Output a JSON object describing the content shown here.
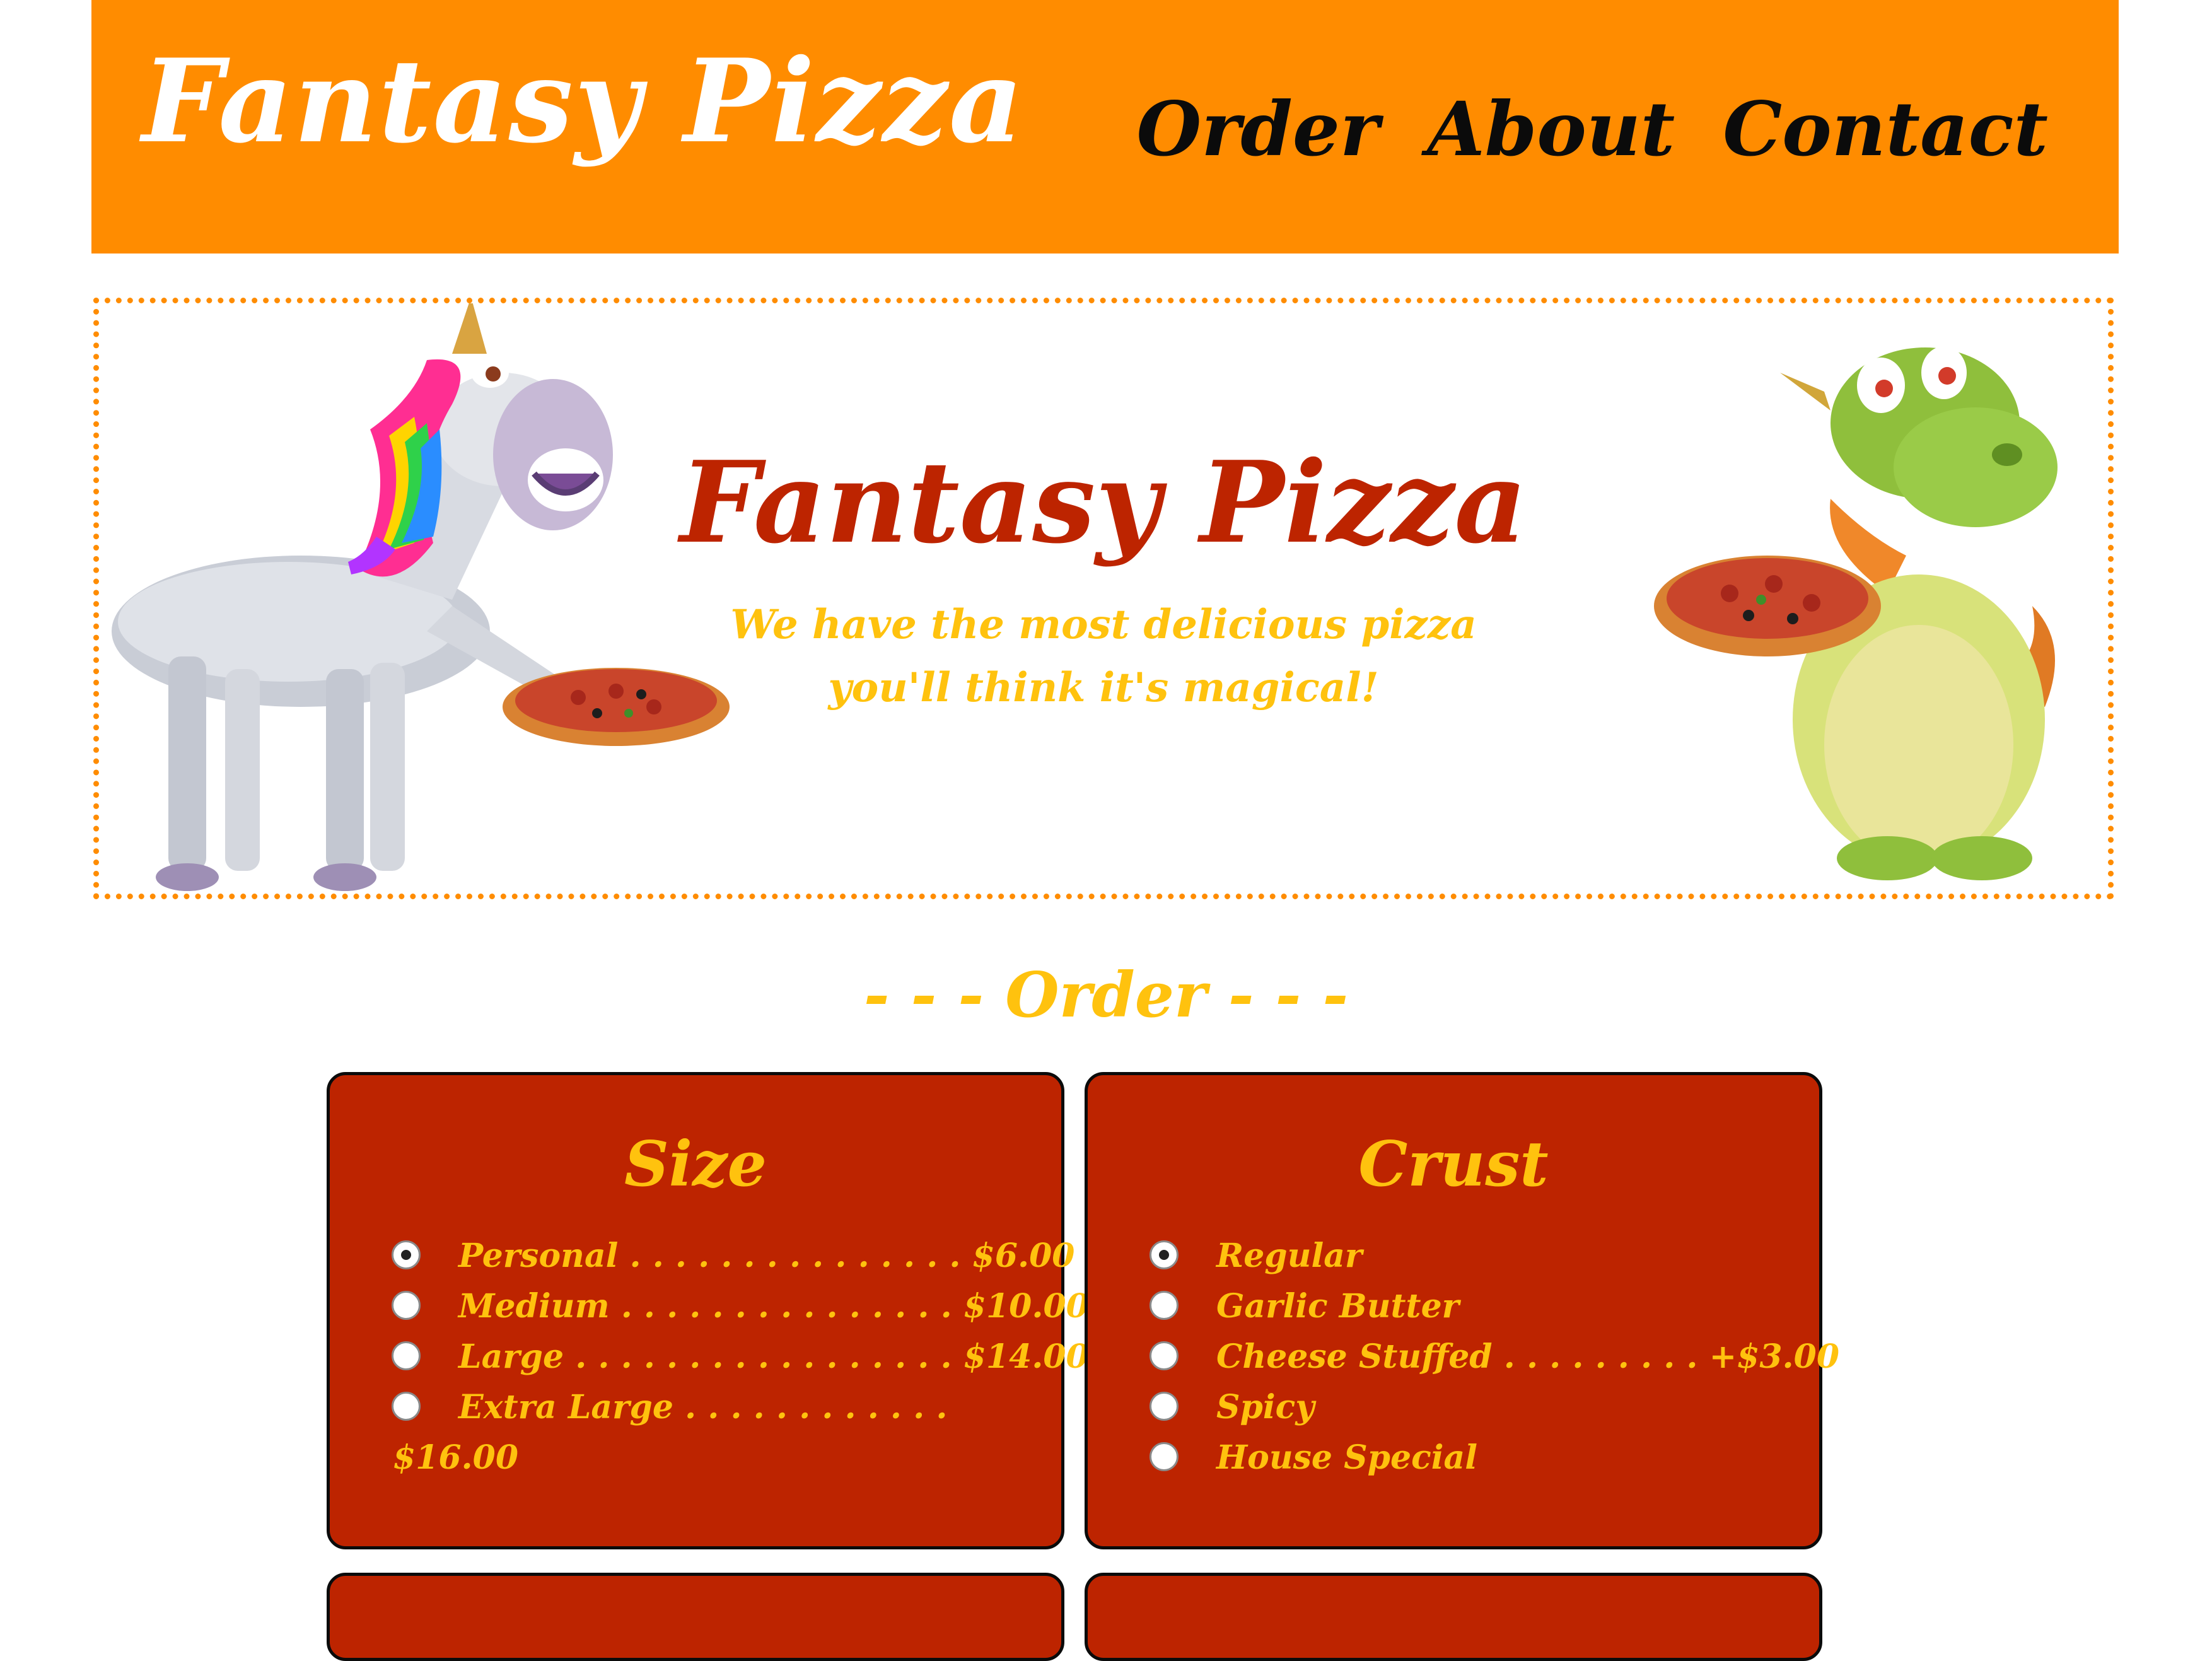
{
  "header": {
    "brand": "Fantasy Pizza",
    "nav": [
      "Order",
      "About",
      "Contact"
    ]
  },
  "hero": {
    "title": "Fantasy Pizza",
    "tagline_line1": "We have the most delicious pizza",
    "tagline_line2": "you'll think it's magical!"
  },
  "order": {
    "heading": "- - - Order - - -",
    "size": {
      "title": "Size",
      "options": [
        {
          "label": "Personal . . . . . . . . . . . . . . . $6.00",
          "checked": true
        },
        {
          "label": "Medium . . . . . . . . . . . . . . . $10.00",
          "checked": false
        },
        {
          "label": "Large . . . . . . . . . . . . . . . . . $14.00",
          "checked": false
        },
        {
          "label": "Extra Large . . . . . . . . . . . .",
          "continuation": "$16.00",
          "checked": false
        }
      ]
    },
    "crust": {
      "title": "Crust",
      "options": [
        {
          "label": "Regular",
          "checked": true
        },
        {
          "label": "Garlic Butter",
          "checked": false
        },
        {
          "label": "Cheese Stuffed . . . . . . . . . +$3.00",
          "checked": false
        },
        {
          "label": "Spicy",
          "checked": false
        },
        {
          "label": "House Special",
          "checked": false
        }
      ]
    }
  },
  "colors": {
    "header_bg": "#ff8c00",
    "accent_red": "#bd2400",
    "accent_yellow": "#ffc20e"
  }
}
